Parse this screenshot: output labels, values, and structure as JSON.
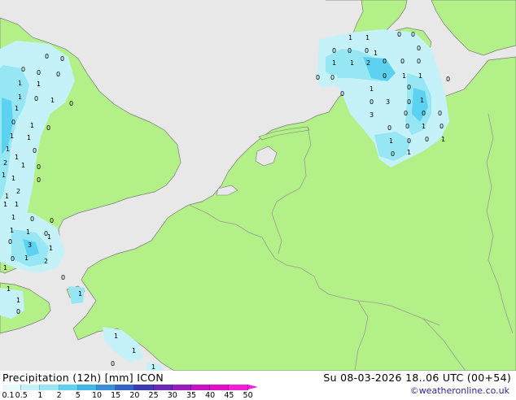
{
  "map": {
    "colors": {
      "land": "#b4f088",
      "sea": "#e8e8e8",
      "border": "#9a9a9a",
      "coast": "#7a7a7a"
    },
    "labels": [
      {
        "id": "uk-1",
        "text": "0"
      },
      {
        "id": "uk-2",
        "text": "0"
      },
      {
        "id": "uk-3",
        "text": "0"
      },
      {
        "id": "uk-4",
        "text": "0"
      },
      {
        "id": "uk-5",
        "text": "0"
      },
      {
        "id": "uk-6",
        "text": "1"
      },
      {
        "id": "uk-7",
        "text": "1"
      },
      {
        "id": "uk-8",
        "text": "1"
      },
      {
        "id": "uk-9",
        "text": "1"
      },
      {
        "id": "uk-10",
        "text": "0"
      },
      {
        "id": "uk-11",
        "text": "1"
      },
      {
        "id": "uk-12",
        "text": "0"
      },
      {
        "id": "uk-13",
        "text": "0"
      },
      {
        "id": "uk-14",
        "text": "1"
      },
      {
        "id": "uk-15",
        "text": "1"
      },
      {
        "id": "uk-16",
        "text": "0"
      },
      {
        "id": "uk-17",
        "text": "1"
      },
      {
        "id": "uk-18",
        "text": "1"
      },
      {
        "id": "uk-19",
        "text": "0"
      },
      {
        "id": "uk-20",
        "text": "1"
      },
      {
        "id": "uk-21",
        "text": "1"
      },
      {
        "id": "uk-22",
        "text": "0"
      },
      {
        "id": "uk-23",
        "text": "2"
      },
      {
        "id": "uk-24",
        "text": "1"
      },
      {
        "id": "uk-25",
        "text": "1"
      },
      {
        "id": "uk-26",
        "text": "0"
      },
      {
        "id": "uk-27",
        "text": "2"
      },
      {
        "id": "uk-28",
        "text": "1"
      },
      {
        "id": "uk-29",
        "text": "1"
      },
      {
        "id": "uk-30",
        "text": "1"
      },
      {
        "id": "uk-31",
        "text": "0"
      },
      {
        "id": "uk-32",
        "text": "0"
      },
      {
        "id": "uk-33",
        "text": "1"
      },
      {
        "id": "uk-34",
        "text": "1"
      },
      {
        "id": "uk-35",
        "text": "0"
      },
      {
        "id": "uk-36",
        "text": "3"
      },
      {
        "id": "uk-37",
        "text": "1"
      },
      {
        "id": "uk-38",
        "text": "1"
      },
      {
        "id": "uk-39",
        "text": "1"
      },
      {
        "id": "uk-40",
        "text": "2"
      },
      {
        "id": "uk-41",
        "text": "0"
      },
      {
        "id": "uk-42",
        "text": "0"
      },
      {
        "id": "uk-43",
        "text": "1"
      },
      {
        "id": "uk-44",
        "text": "1"
      },
      {
        "id": "uk-45",
        "text": "0"
      },
      {
        "id": "uk-46",
        "text": "1"
      },
      {
        "id": "uk-47",
        "text": "1"
      },
      {
        "id": "uk-48",
        "text": "0"
      },
      {
        "id": "uk-49",
        "text": "1"
      },
      {
        "id": "dk-1",
        "text": "1"
      },
      {
        "id": "dk-2",
        "text": "1"
      },
      {
        "id": "dk-3",
        "text": "0"
      },
      {
        "id": "dk-4",
        "text": "0"
      },
      {
        "id": "dk-5",
        "text": "0"
      },
      {
        "id": "dk-6",
        "text": "0"
      },
      {
        "id": "dk-7",
        "text": "0"
      },
      {
        "id": "dk-8",
        "text": "1"
      },
      {
        "id": "dk-9",
        "text": "1"
      },
      {
        "id": "dk-10",
        "text": "1"
      },
      {
        "id": "dk-11",
        "text": "2"
      },
      {
        "id": "dk-12",
        "text": "0"
      },
      {
        "id": "dk-13",
        "text": "0"
      },
      {
        "id": "dk-14",
        "text": "0"
      },
      {
        "id": "dk-15",
        "text": "0"
      },
      {
        "id": "dk-16",
        "text": "0"
      },
      {
        "id": "dk-17",
        "text": "0"
      },
      {
        "id": "dk-18",
        "text": "0"
      },
      {
        "id": "dk-19",
        "text": "1"
      },
      {
        "id": "dk-20",
        "text": "1"
      },
      {
        "id": "dk-21",
        "text": "1"
      },
      {
        "id": "dk-22",
        "text": "0"
      },
      {
        "id": "dk-23",
        "text": "0"
      },
      {
        "id": "dk-24",
        "text": "0"
      },
      {
        "id": "dk-25",
        "text": "3"
      },
      {
        "id": "dk-26",
        "text": "0"
      },
      {
        "id": "dk-27",
        "text": "1"
      },
      {
        "id": "dk-28",
        "text": "3"
      },
      {
        "id": "dk-29",
        "text": "0"
      },
      {
        "id": "dk-30",
        "text": "0"
      },
      {
        "id": "dk-31",
        "text": "0"
      },
      {
        "id": "dk-32",
        "text": "0"
      },
      {
        "id": "dk-33",
        "text": "0"
      },
      {
        "id": "dk-34",
        "text": "1"
      },
      {
        "id": "dk-35",
        "text": "0"
      },
      {
        "id": "dk-36",
        "text": "1"
      },
      {
        "id": "dk-37",
        "text": "0"
      },
      {
        "id": "dk-38",
        "text": "0"
      },
      {
        "id": "dk-39",
        "text": "1"
      },
      {
        "id": "dk-40",
        "text": "0"
      },
      {
        "id": "dk-41",
        "text": "1"
      },
      {
        "id": "dk-42",
        "text": "0"
      },
      {
        "id": "ch-1",
        "text": "1"
      },
      {
        "id": "ch-2",
        "text": "1"
      },
      {
        "id": "ch-3",
        "text": "0"
      },
      {
        "id": "ch-4",
        "text": "1"
      }
    ]
  },
  "footer": {
    "title": "Precipitation (12h) [mm] ICON",
    "validity": "Su 08-03-2026 18..06 UTC (00+54)",
    "copyright": "©weatheronline.co.uk"
  },
  "colorbar": {
    "ticks": [
      "0.1",
      "0.5",
      "1",
      "2",
      "5",
      "10",
      "15",
      "20",
      "25",
      "30",
      "35",
      "40",
      "45",
      "50"
    ],
    "colors": [
      "#e6fafc",
      "#c4f2f8",
      "#96e6f4",
      "#5cd2f0",
      "#40b6e8",
      "#3a8fd8",
      "#3464c8",
      "#3a3cb4",
      "#6a28b8",
      "#9a1cbe",
      "#c414c4",
      "#e010c8",
      "#f020d8"
    ]
  }
}
